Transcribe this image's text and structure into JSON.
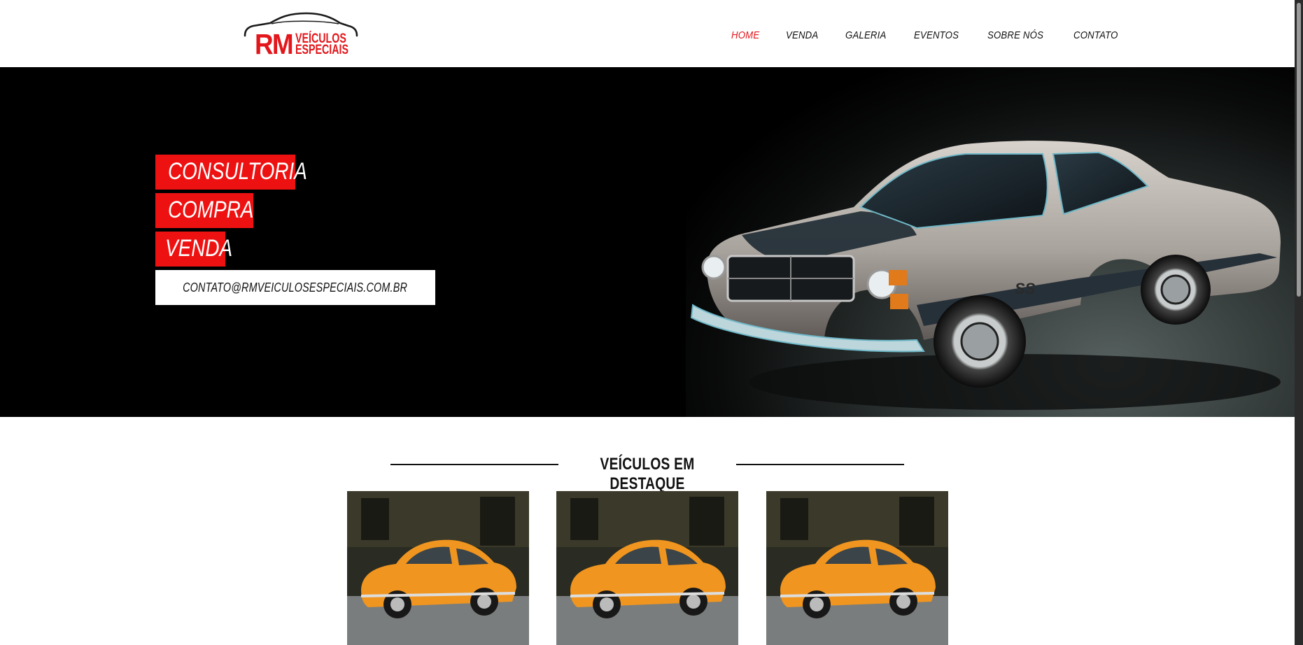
{
  "header": {
    "logo": {
      "brand_short": "RM",
      "brand_line1": "VEÍCULOS",
      "brand_line2": "ESPECIAIS"
    },
    "nav": [
      {
        "label": "HOME",
        "active": true
      },
      {
        "label": "VENDA",
        "active": false
      },
      {
        "label": "GALERIA",
        "active": false
      },
      {
        "label": "EVENTOS",
        "active": false
      },
      {
        "label": "SOBRE NÓS",
        "active": false
      },
      {
        "label": "CONTATO",
        "active": false
      }
    ]
  },
  "hero": {
    "tags": [
      "CONSULTORIA",
      "COMPRA",
      "VENDA"
    ],
    "email": "CONTATO@RMVEICULOSESPECIAIS.COM.BR",
    "car_badge": "SS"
  },
  "featured": {
    "title": "VEÍCULOS EM DESTAQUE",
    "cards": [
      {
        "image": "orange-classic-coupe-photo"
      },
      {
        "image": "orange-classic-coupe-photo"
      },
      {
        "image": "orange-classic-coupe-photo"
      }
    ]
  },
  "colors": {
    "accent": "#e3161b",
    "hero_bg": "#000000",
    "text": "#111111"
  }
}
